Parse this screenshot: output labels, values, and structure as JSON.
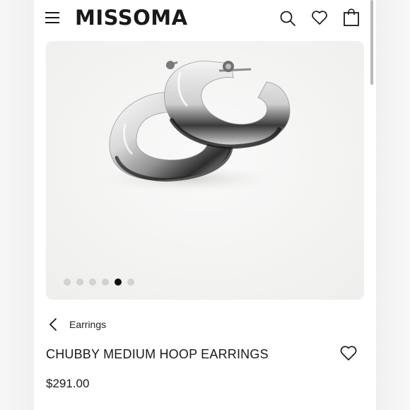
{
  "header": {
    "logo_text": "MISSOMA",
    "menu_icon": "hamburger-menu-icon",
    "search_icon": "search-icon",
    "wishlist_icon": "heart-icon",
    "bag_icon": "shopping-bag-icon"
  },
  "carousel": {
    "slide_count": 6,
    "active_slide": 5,
    "image_alt": "Chubby medium hoop earrings in silver"
  },
  "breadcrumb": {
    "back_icon": "chevron-left-icon",
    "label": "Earrings"
  },
  "product": {
    "name": "CHUBBY MEDIUM HOOP EARRINGS",
    "price": "$291.00",
    "favorite_icon": "heart-icon"
  },
  "colors": {
    "text": "#1a1a1a",
    "image_background": "#f5f5f4",
    "dot_active": "#111111",
    "dot_inactive": "#d2d2d2"
  }
}
